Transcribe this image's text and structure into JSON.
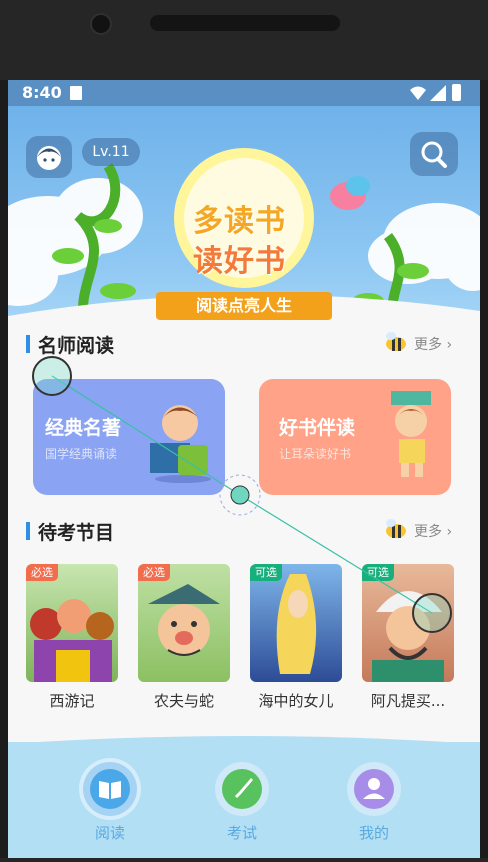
{
  "status_bar": {
    "time": "8:40"
  },
  "header": {
    "level_badge": "Lv.11"
  },
  "banner": {
    "title_line1": "多读书",
    "title_line2": "读好书",
    "ribbon": "阅读点亮人生"
  },
  "section1": {
    "title": "名师阅读",
    "more": "更多",
    "cards": [
      {
        "title": "经典名著",
        "subtitle": "国学经典诵读",
        "color": "#8aa3f2"
      },
      {
        "title": "好书伴读",
        "subtitle": "让耳朵读好书",
        "color": "#ffa287"
      }
    ]
  },
  "section2": {
    "title": "待考节目",
    "more": "更多",
    "books": [
      {
        "tag": "必选",
        "name": "西游记"
      },
      {
        "tag": "必选",
        "name": "农夫与蛇"
      },
      {
        "tag": "可选",
        "name": "海中的女儿"
      },
      {
        "tag": "可选",
        "name": "阿凡提买..."
      }
    ]
  },
  "tabbar": {
    "tabs": [
      {
        "label": "阅读"
      },
      {
        "label": "考试"
      },
      {
        "label": "我的"
      }
    ]
  },
  "colors": {
    "accent": "#2f8fe6",
    "required_tag": "#f26d4d",
    "optional_tag": "#17b07d",
    "tab_label": "#5aa9e0"
  }
}
